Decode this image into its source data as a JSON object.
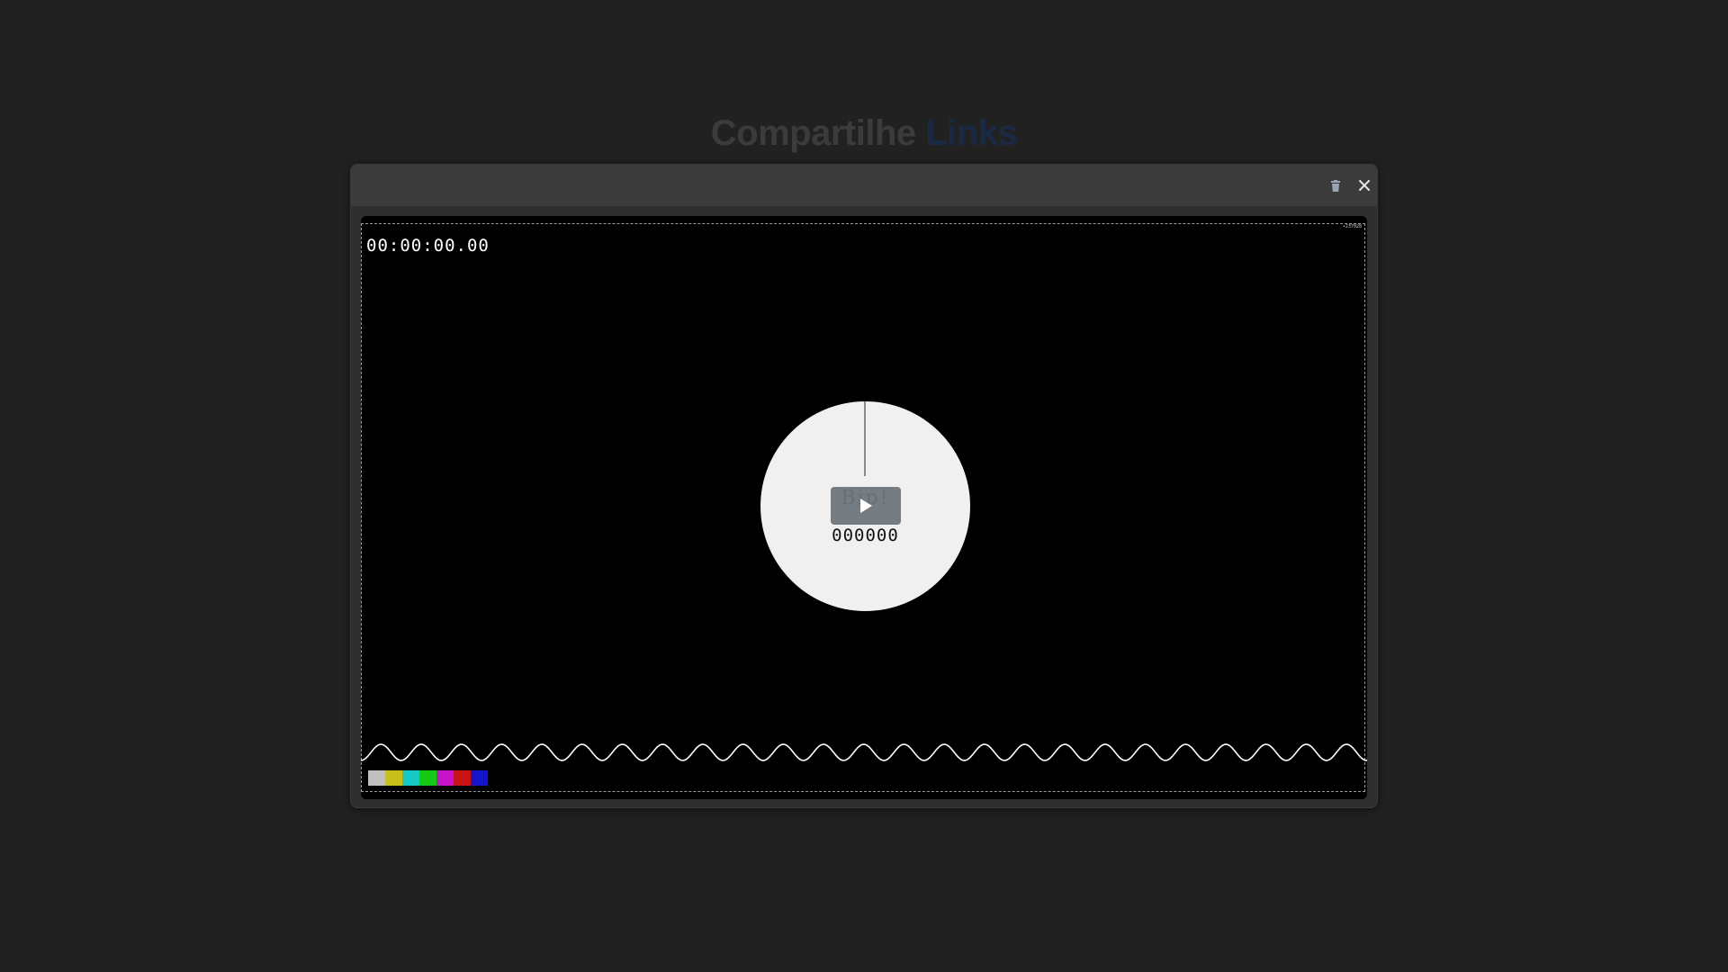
{
  "page": {
    "title_main": "Compartilhe",
    "title_accent": "Links"
  },
  "modal": {
    "trash_icon": "trash-icon",
    "close_icon": "close-icon",
    "close_glyph": "✕"
  },
  "video": {
    "timecode": "00:00:00.00",
    "corner_id": "•237028",
    "dial_text": "Bip!",
    "counter": "000000",
    "play_icon": "play-icon",
    "color_bars": [
      "#c0c0c0",
      "#c8c01a",
      "#14c8c8",
      "#14c814",
      "#c814c8",
      "#c81414",
      "#1414c8"
    ]
  }
}
